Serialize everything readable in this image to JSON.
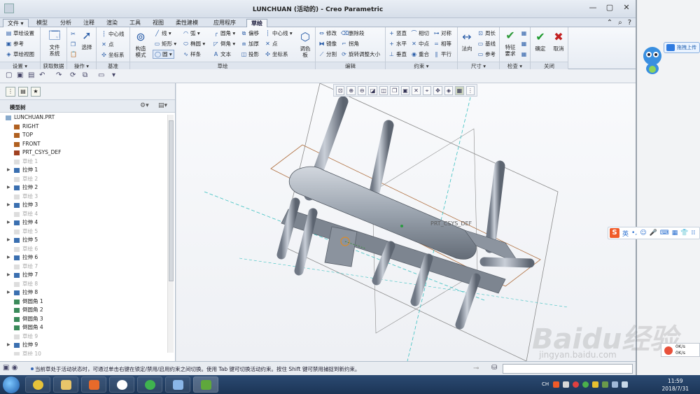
{
  "app": {
    "title": "LUNCHUAN (活动的) - Creo Parametric",
    "window_controls": [
      "—",
      "▢",
      "✕"
    ]
  },
  "ribbon_tabs": [
    {
      "label": "文件 ▾",
      "kind": "file"
    },
    {
      "label": "模型"
    },
    {
      "label": "分析"
    },
    {
      "label": "注释"
    },
    {
      "label": "渲染"
    },
    {
      "label": "工具"
    },
    {
      "label": "视图"
    },
    {
      "label": "柔性建模"
    },
    {
      "label": "应用程序"
    },
    {
      "label": "草绘",
      "kind": "active"
    }
  ],
  "ribbon": {
    "settings": {
      "items": [
        "草绘设置",
        "参考",
        "草绘视图"
      ],
      "group": "设置 ▾"
    },
    "getdata": {
      "file_system": "文件\n系统",
      "group": "获取数据"
    },
    "operations": {
      "select": "选择",
      "group": "操作 ▾"
    },
    "datum": {
      "items": [
        "中心线",
        "点",
        "坐标系"
      ],
      "group": "基准"
    },
    "sketch": {
      "construction": "构造\n模式",
      "col1": [
        "线 ▾",
        "矩形 ▾",
        "圆 ▾"
      ],
      "col2": [
        "弧 ▾",
        "椭圆 ▾",
        "样条"
      ],
      "col3": [
        "圆角 ▾",
        "倒角 ▾",
        "文本"
      ],
      "col4": [
        "偏移",
        "加厚",
        "投影"
      ],
      "col5": [
        "中心线 ▾",
        "点",
        "坐标系"
      ],
      "palette": "调色\n板",
      "group": "草绘"
    },
    "edit": {
      "col1": [
        "修改",
        "镜像",
        "分割"
      ],
      "col2": [
        "删除段",
        "拐角",
        "旋转调整大小"
      ],
      "group": "编辑"
    },
    "constrain": {
      "col1": [
        "竖直",
        "水平",
        "垂直"
      ],
      "col2": [
        "相切",
        "中点",
        "重合"
      ],
      "col3": [
        "对称",
        "相等",
        "平行"
      ],
      "group": "约束 ▾"
    },
    "dimension": {
      "normal": "法向",
      "col": [
        "周长",
        "基线",
        "参考"
      ],
      "group": "尺寸 ▾"
    },
    "inspect": {
      "feature": "特征\n要求",
      "group": "检查 ▾"
    },
    "close": {
      "ok": "确定",
      "cancel": "取消",
      "group": "关闭"
    }
  },
  "model_tree": {
    "header": "模型树",
    "items": [
      {
        "label": "LUNCHUAN.PRT",
        "type": "part",
        "indent": 0,
        "dim": false,
        "arrow": false
      },
      {
        "label": "RIGHT",
        "type": "plane",
        "indent": 1,
        "dim": false,
        "arrow": false
      },
      {
        "label": "TOP",
        "type": "plane",
        "indent": 1,
        "dim": false,
        "arrow": false
      },
      {
        "label": "FRONT",
        "type": "plane",
        "indent": 1,
        "dim": false,
        "arrow": false
      },
      {
        "label": "PRT_CSYS_DEF",
        "type": "csys",
        "indent": 1,
        "dim": false,
        "arrow": false
      },
      {
        "label": "草绘 1",
        "type": "sketch",
        "indent": 1,
        "dim": true,
        "arrow": false
      },
      {
        "label": "拉伸 1",
        "type": "extrude",
        "indent": 1,
        "dim": false,
        "arrow": true
      },
      {
        "label": "草绘 2",
        "type": "sketch",
        "indent": 1,
        "dim": true,
        "arrow": false
      },
      {
        "label": "拉伸 2",
        "type": "extrude",
        "indent": 1,
        "dim": false,
        "arrow": true
      },
      {
        "label": "草绘 3",
        "type": "sketch",
        "indent": 1,
        "dim": true,
        "arrow": false
      },
      {
        "label": "拉伸 3",
        "type": "extrude",
        "indent": 1,
        "dim": false,
        "arrow": true
      },
      {
        "label": "草绘 4",
        "type": "sketch",
        "indent": 1,
        "dim": true,
        "arrow": false
      },
      {
        "label": "拉伸 4",
        "type": "extrude",
        "indent": 1,
        "dim": false,
        "arrow": true
      },
      {
        "label": "草绘 5",
        "type": "sketch",
        "indent": 1,
        "dim": true,
        "arrow": false
      },
      {
        "label": "拉伸 5",
        "type": "extrude",
        "indent": 1,
        "dim": false,
        "arrow": true
      },
      {
        "label": "草绘 6",
        "type": "sketch",
        "indent": 1,
        "dim": true,
        "arrow": false
      },
      {
        "label": "拉伸 6",
        "type": "extrude",
        "indent": 1,
        "dim": false,
        "arrow": true
      },
      {
        "label": "草绘 7",
        "type": "sketch",
        "indent": 1,
        "dim": true,
        "arrow": false
      },
      {
        "label": "拉伸 7",
        "type": "extrude",
        "indent": 1,
        "dim": false,
        "arrow": true
      },
      {
        "label": "草绘 8",
        "type": "sketch",
        "indent": 1,
        "dim": true,
        "arrow": false
      },
      {
        "label": "拉伸 8",
        "type": "extrude",
        "indent": 1,
        "dim": false,
        "arrow": true
      },
      {
        "label": "倒圆角 1",
        "type": "round",
        "indent": 1,
        "dim": false,
        "arrow": false
      },
      {
        "label": "倒圆角 2",
        "type": "round",
        "indent": 1,
        "dim": false,
        "arrow": false
      },
      {
        "label": "倒圆角 3",
        "type": "round",
        "indent": 1,
        "dim": false,
        "arrow": false
      },
      {
        "label": "倒圆角 4",
        "type": "round",
        "indent": 1,
        "dim": false,
        "arrow": false
      },
      {
        "label": "草绘 9",
        "type": "sketch",
        "indent": 1,
        "dim": true,
        "arrow": false
      },
      {
        "label": "拉伸 9",
        "type": "extrude",
        "indent": 1,
        "dim": false,
        "arrow": true
      },
      {
        "label": "草绘 10",
        "type": "sketch",
        "indent": 1,
        "dim": true,
        "arrow": false
      }
    ]
  },
  "graphics": {
    "csys_label": "PRT_CSYS_DEF"
  },
  "status": {
    "message": "当前草处于活动状态时，可通过单击右键在锁定/禁用/启用约束之间切换。使用 Tab 键可切换活动约束。按住 Shift 键可禁用捕捉到新约束。"
  },
  "desktop": {
    "pill_text": "拖拽上传",
    "sogou_label": "英",
    "net_up": "0K/s",
    "net_down": "0K/s",
    "watermark": "Baidu经验",
    "watermark_url": "jingyan.baidu.com"
  },
  "taskbar": {
    "lang": "CH",
    "time": "11:59",
    "date": "2018/7/31"
  }
}
